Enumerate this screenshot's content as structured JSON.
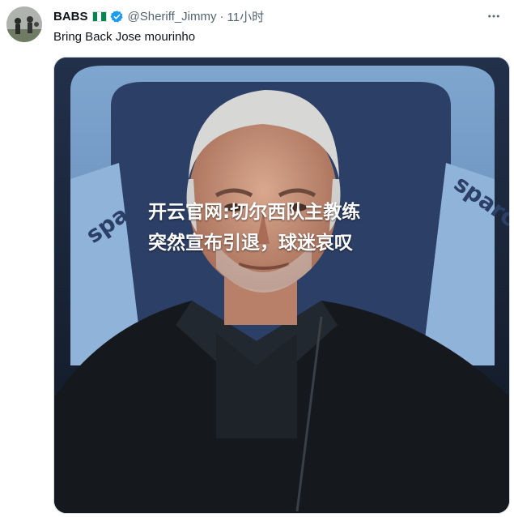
{
  "tweet": {
    "author_name": "BABS",
    "handle": "@Sheriff_Jimmy",
    "separator": "·",
    "time": "11小时",
    "text": "Bring Back Jose mourinho",
    "icons": {
      "flag": "nigeria-flag-icon",
      "verified": "verified-badge-icon",
      "more": "more-options-icon"
    },
    "colors": {
      "verified": "#1d9bf0",
      "flag_green": "#008751",
      "flag_white": "#ffffff"
    }
  },
  "media": {
    "overlay_text": "开云官网:切尔西队主教练突然宣布引退，球迷哀叹",
    "seat_brand_left": "sparco",
    "seat_brand_right": "sparco"
  }
}
